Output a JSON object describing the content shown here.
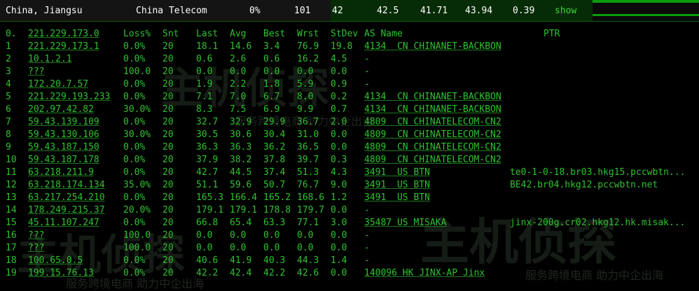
{
  "topbar": {
    "location": "China, Jiangsu",
    "isp": "China Telecom",
    "loss": "0%",
    "sent": "101",
    "last": "42",
    "avg": "42.5",
    "best": "41.71",
    "worst": "43.94",
    "stdev": "0.39",
    "show_label": "show"
  },
  "watermark": {
    "logo_text": "主机侦探",
    "slogan": "服务跨境电商 助力中企出海"
  },
  "headers": {
    "num": "0.",
    "host": "221.229.173.0",
    "loss": "Loss%",
    "snt": "Snt",
    "last": "Last",
    "avg": "Avg",
    "best": "Best",
    "wrst": "Wrst",
    "stdev": "StDev",
    "asname": "AS Name",
    "ptr": "PTR"
  },
  "rows": [
    {
      "n": "1",
      "host": "221.229.173.1",
      "loss": "0.0%",
      "snt": "20",
      "last": "18.1",
      "avg": "14.6",
      "best": "3.4",
      "wrst": "76.9",
      "stdev": "19.8",
      "asn": "4134",
      "cc": "CN",
      "asname": "CHINANET-BACKBON",
      "ptr": ""
    },
    {
      "n": "2",
      "host": "10.1.2.1",
      "loss": "0.0%",
      "snt": "20",
      "last": "0.6",
      "avg": "2.6",
      "best": "0.6",
      "wrst": "16.2",
      "stdev": "4.5",
      "asn": "",
      "cc": "",
      "asname": "-",
      "ptr": ""
    },
    {
      "n": "3",
      "host": "???",
      "loss": "100.0",
      "snt": "20",
      "last": "0.0",
      "avg": "0.0",
      "best": "0.0",
      "wrst": "0.0",
      "stdev": "0.0",
      "asn": "",
      "cc": "",
      "asname": "-",
      "ptr": ""
    },
    {
      "n": "4",
      "host": "172.20.7.57",
      "loss": "0.0%",
      "snt": "20",
      "last": "1.9",
      "avg": "2.2",
      "best": "1.8",
      "wrst": "5.9",
      "stdev": "0.9",
      "asn": "",
      "cc": "",
      "asname": "-",
      "ptr": ""
    },
    {
      "n": "5",
      "host": "221.229.193.233",
      "loss": "0.0%",
      "snt": "20",
      "last": "7.1",
      "avg": "7.0",
      "best": "6.7",
      "wrst": "8.0",
      "stdev": "0.2",
      "asn": "4134",
      "cc": "CN",
      "asname": "CHINANET-BACKBON",
      "ptr": ""
    },
    {
      "n": "6",
      "host": "202.97.42.82",
      "loss": "30.0%",
      "snt": "20",
      "last": "8.3",
      "avg": "7.5",
      "best": "6.9",
      "wrst": "9.9",
      "stdev": "0.7",
      "asn": "4134",
      "cc": "CN",
      "asname": "CHINANET-BACKBON",
      "ptr": ""
    },
    {
      "n": "7",
      "host": "59.43.139.109",
      "loss": "0.0%",
      "snt": "20",
      "last": "32.7",
      "avg": "32.9",
      "best": "29.9",
      "wrst": "36.7",
      "stdev": "2.0",
      "asn": "4809",
      "cc": "CN",
      "asname": "CHINATELECOM-CN2",
      "ptr": ""
    },
    {
      "n": "8",
      "host": "59.43.130.106",
      "loss": "30.0%",
      "snt": "20",
      "last": "30.5",
      "avg": "30.6",
      "best": "30.4",
      "wrst": "31.0",
      "stdev": "0.0",
      "asn": "4809",
      "cc": "CN",
      "asname": "CHINATELECOM-CN2",
      "ptr": ""
    },
    {
      "n": "9",
      "host": "59.43.187.150",
      "loss": "0.0%",
      "snt": "20",
      "last": "36.3",
      "avg": "36.3",
      "best": "36.2",
      "wrst": "36.5",
      "stdev": "0.0",
      "asn": "4809",
      "cc": "CN",
      "asname": "CHINATELECOM-CN2",
      "ptr": ""
    },
    {
      "n": "10",
      "host": "59.43.187.178",
      "loss": "0.0%",
      "snt": "20",
      "last": "37.9",
      "avg": "38.2",
      "best": "37.8",
      "wrst": "39.7",
      "stdev": "0.3",
      "asn": "4809",
      "cc": "CN",
      "asname": "CHINATELECOM-CN2",
      "ptr": ""
    },
    {
      "n": "11",
      "host": "63.218.211.9",
      "loss": "0.0%",
      "snt": "20",
      "last": "42.7",
      "avg": "44.5",
      "best": "37.4",
      "wrst": "51.3",
      "stdev": "4.3",
      "asn": "3491",
      "cc": "US",
      "asname": "BTN",
      "ptr": "te0-1-0-18.br03.hkg15.pccwbtn..."
    },
    {
      "n": "12",
      "host": "63.218.174.134",
      "loss": "35.0%",
      "snt": "20",
      "last": "51.1",
      "avg": "59.6",
      "best": "50.7",
      "wrst": "76.7",
      "stdev": "9.0",
      "asn": "3491",
      "cc": "US",
      "asname": "BTN",
      "ptr": "BE42.br04.hkg12.pccwbtn.net"
    },
    {
      "n": "13",
      "host": "63.217.254.210",
      "loss": "0.0%",
      "snt": "20",
      "last": "165.3",
      "avg": "166.4",
      "best": "165.2",
      "wrst": "168.6",
      "stdev": "1.2",
      "asn": "3491",
      "cc": "US",
      "asname": "BTN",
      "ptr": ""
    },
    {
      "n": "14",
      "host": "178.249.215.37",
      "loss": "20.0%",
      "snt": "20",
      "last": "179.1",
      "avg": "179.1",
      "best": "178.8",
      "wrst": "179.7",
      "stdev": "0.0",
      "asn": "",
      "cc": "",
      "asname": "-",
      "ptr": ""
    },
    {
      "n": "15",
      "host": "45.11.107.247",
      "loss": "0.0%",
      "snt": "20",
      "last": "66.8",
      "avg": "65.4",
      "best": "63.3",
      "wrst": "77.1",
      "stdev": "3.0",
      "asn": "35487",
      "cc": "US",
      "asname": "MISAKA",
      "ptr": "jinx-200g.cr02.hkg12.hk.misak..."
    },
    {
      "n": "16",
      "host": "???",
      "loss": "100.0",
      "snt": "20",
      "last": "0.0",
      "avg": "0.0",
      "best": "0.0",
      "wrst": "0.0",
      "stdev": "0.0",
      "asn": "",
      "cc": "",
      "asname": "-",
      "ptr": ""
    },
    {
      "n": "17",
      "host": "???",
      "loss": "100.0",
      "snt": "20",
      "last": "0.0",
      "avg": "0.0",
      "best": "0.0",
      "wrst": "0.0",
      "stdev": "0.0",
      "asn": "",
      "cc": "",
      "asname": "-",
      "ptr": ""
    },
    {
      "n": "18",
      "host": "100.65.0.5",
      "loss": "0.0%",
      "snt": "20",
      "last": "40.6",
      "avg": "41.9",
      "best": "40.3",
      "wrst": "44.3",
      "stdev": "1.4",
      "asn": "",
      "cc": "",
      "asname": "-",
      "ptr": ""
    },
    {
      "n": "19",
      "host": "199.15.76.13",
      "loss": "0.0%",
      "snt": "20",
      "last": "42.2",
      "avg": "42.4",
      "best": "42.2",
      "wrst": "42.6",
      "stdev": "0.0",
      "asn": "140096",
      "cc": "HK",
      "asname": "JINX-AP Jinx",
      "ptr": ""
    }
  ]
}
